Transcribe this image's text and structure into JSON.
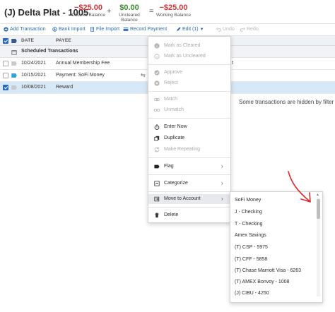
{
  "header": {
    "account_name": "(J) Delta Plat - 1005",
    "cleared": {
      "amount": "−$25.00",
      "label": "Cleared Balance"
    },
    "op_plus": "+",
    "uncleared": {
      "amount": "$0.00",
      "label": "Uncleared Balance"
    },
    "op_equals": "=",
    "working": {
      "amount": "−$25.00",
      "label": "Working Balance"
    }
  },
  "toolbar": {
    "add": "Add Transaction",
    "bank_import": "Bank Import",
    "file_import": "File Import",
    "record_payment": "Record Payment",
    "edit": "Edit (1)",
    "undo": "Undo",
    "redo": "Redo"
  },
  "columns": {
    "date": "DATE",
    "payee": "PAYEE"
  },
  "scheduled": {
    "label": "Scheduled Transactions"
  },
  "rows": [
    {
      "date": "10/24/2021",
      "payee": "Annual Membership Fee",
      "extra": "t"
    },
    {
      "date": "10/15/2021",
      "payee": "Payment: SoFi Money"
    },
    {
      "date": "10/08/2021",
      "payee": "Reward"
    }
  ],
  "hidden_note": "Some transactions are hidden by filter",
  "menu": {
    "mark_cleared": "Mark as Cleared",
    "mark_uncleared": "Mark as Uncleared",
    "approve": "Approve",
    "reject": "Reject",
    "match": "Match",
    "unmatch": "Unmatch",
    "enter_now": "Enter Now",
    "duplicate": "Duplicate",
    "make_repeating": "Make Repeating",
    "flag": "Flag",
    "categorize": "Categorize",
    "move_to_account": "Move to Account",
    "delete": "Delete"
  },
  "submenu": {
    "accounts": [
      "SoFi Money",
      "J - Checking",
      "T - Checking",
      "Amex Savings",
      "(T) CSP - 5975",
      "(T) CFF - 5858",
      "(T) Chase Marriott Visa - 6263",
      "(T) AMEX Bonvoy - 1008",
      "(J) CIBU - 4250"
    ]
  },
  "colors": {
    "accent": "#2c6ab8",
    "negative": "#d0363b",
    "positive": "#3c8a2e",
    "annotation": "#e0262b"
  }
}
